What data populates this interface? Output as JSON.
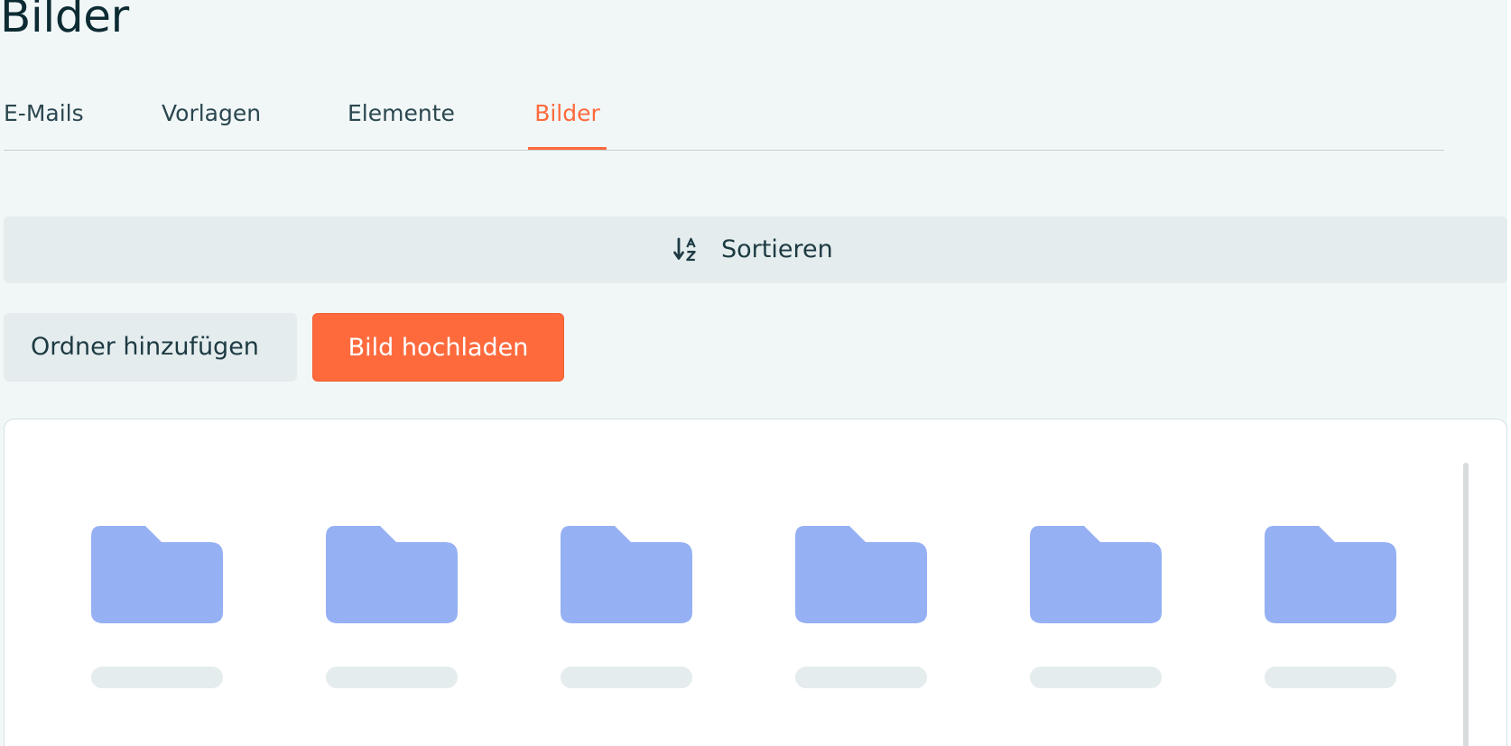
{
  "page": {
    "title": "Bilder"
  },
  "tabs": [
    {
      "label": "E-Mails",
      "active": false
    },
    {
      "label": "Vorlagen",
      "active": false
    },
    {
      "label": "Elemente",
      "active": false
    },
    {
      "label": "Bilder",
      "active": true
    }
  ],
  "toolbar": {
    "sort_label": "Sortieren",
    "sort_icon": "sort-alpha-icon",
    "add_folder_label": "Ordner hinzufügen",
    "upload_label": "Bild hochladen"
  },
  "gallery": {
    "items": [
      {
        "type": "folder",
        "icon": "folder-icon",
        "label": ""
      },
      {
        "type": "folder",
        "icon": "folder-icon",
        "label": ""
      },
      {
        "type": "folder",
        "icon": "folder-icon",
        "label": ""
      },
      {
        "type": "folder",
        "icon": "folder-icon",
        "label": ""
      },
      {
        "type": "folder",
        "icon": "folder-icon",
        "label": ""
      },
      {
        "type": "folder",
        "icon": "folder-icon",
        "label": ""
      }
    ]
  },
  "colors": {
    "accent": "#ff6a3d",
    "page_background": "#f1f7f7",
    "button_secondary": "#e4eced",
    "folder": "#95b0f3",
    "title_text": "#0d2b33"
  }
}
